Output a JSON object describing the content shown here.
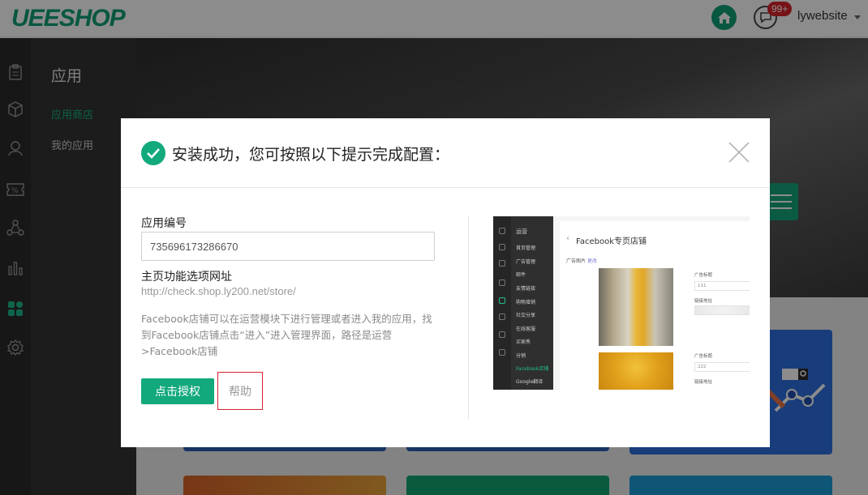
{
  "header": {
    "logo": "UEESHOP",
    "badge_count": "99+",
    "username": "lywebsite",
    "home_icon": "home-icon",
    "message_icon": "chat-icon"
  },
  "sidebar": {
    "icons": [
      "clipboard-icon",
      "cube-icon",
      "user-icon",
      "coupon-icon",
      "share-icon",
      "bar-chart-icon",
      "apps-icon",
      "gear-icon"
    ],
    "active_index": 6
  },
  "subnav": {
    "title": "应用",
    "items": [
      {
        "label": "应用商店",
        "active": true
      },
      {
        "label": "我的应用",
        "active": false
      }
    ]
  },
  "modal": {
    "title": "安装成功，您可按照以下提示完成配置：",
    "app_id_label": "应用编号",
    "app_id_value": "735696173286670",
    "homepage_label": "主页功能选项网址",
    "homepage_url": "http://check.shop.ly200.net/store/",
    "description_lines": [
      "Facebook店铺可以在运营模块下进行管理或者进入我的应用，找",
      "到Facebook店铺点击“进入”进入管理界面，路径是运营",
      ">Facebook店铺"
    ],
    "authorize_button": "点击授权",
    "help_button": "帮助",
    "accent_color": "#12a97c"
  },
  "preview": {
    "nav_header": "运营",
    "nav_items": [
      "首页管理",
      "广告管理",
      "邮件",
      "友情链接",
      "购物增销",
      "社交分享",
      "在线客服",
      "买家秀",
      "分销",
      "Facebook店铺",
      "Google翻译"
    ],
    "active_nav": "Facebook店铺",
    "page_title": "Facebook专页店铺",
    "section_label": "广告图片",
    "section_link": "更改",
    "field1_label": "广告标题",
    "field1_value": "111",
    "field2_label": "链接地址",
    "field3_label": "广告标题",
    "field3_value": "222",
    "field4_label": "链接地址"
  }
}
